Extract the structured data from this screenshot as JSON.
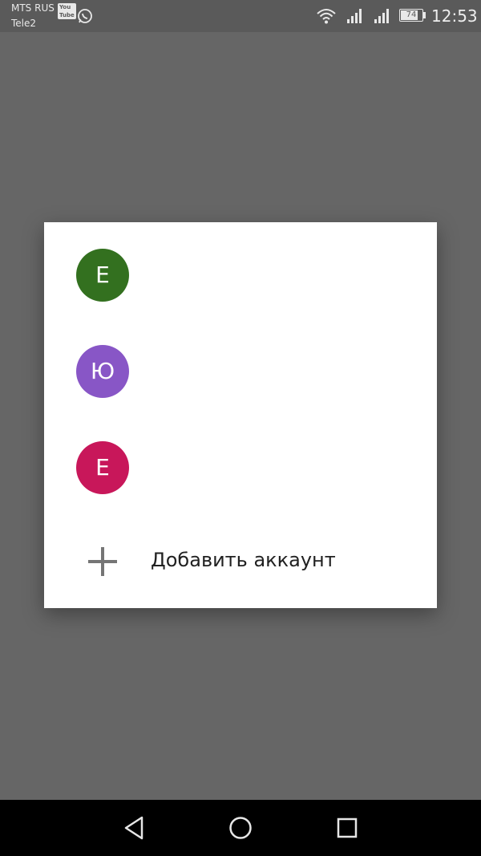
{
  "status_bar": {
    "carrier_primary": "MTS RUS",
    "carrier_badge": "YouTube",
    "carrier_secondary": "Tele2",
    "battery_level": "74",
    "time": "12:53",
    "icons": [
      "whatsapp-icon",
      "wifi-icon",
      "signal-icon",
      "signal-icon",
      "battery-icon"
    ]
  },
  "dialog": {
    "accounts": [
      {
        "initial": "E",
        "color": "#33701f"
      },
      {
        "initial": "Ю",
        "color": "#8856c6"
      },
      {
        "initial": "E",
        "color": "#c8175a"
      }
    ],
    "add_account_label": "Добавить аккаунт",
    "add_icon": "plus-icon"
  },
  "nav_bar": {
    "icons": [
      "back-icon",
      "home-icon",
      "recent-apps-icon"
    ]
  }
}
